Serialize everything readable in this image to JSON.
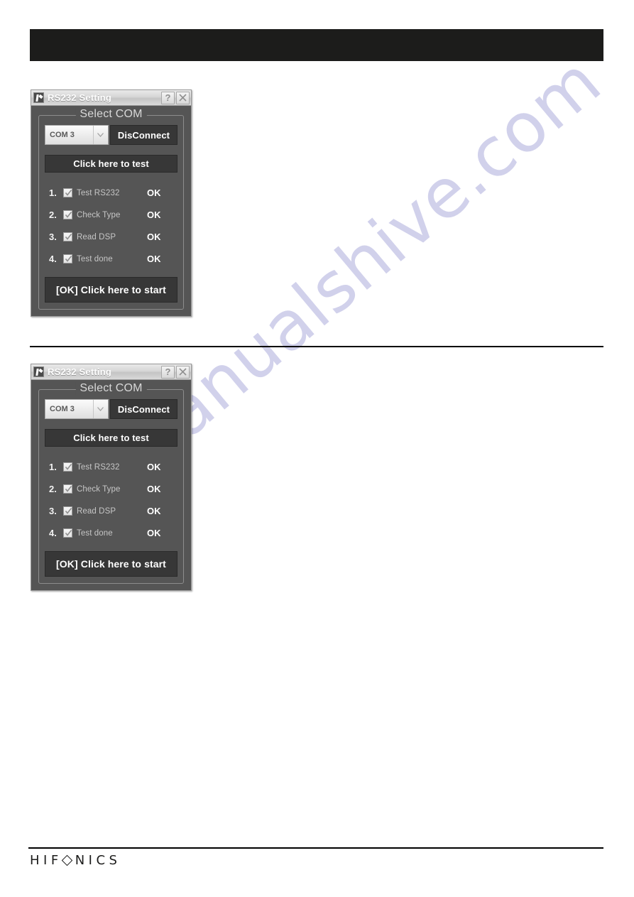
{
  "page": {
    "footer_logo": {
      "part1": "HIF",
      "diamond_icon": "diamond-glyph",
      "part2": "NICS"
    }
  },
  "watermark": {
    "text": "manualshive.com",
    "color": "#c9c9e8"
  },
  "colors": {
    "banner": "#1c1c1b",
    "dialog_bg": "#555555",
    "button_bg": "#373737",
    "rule": "#000000"
  },
  "dialogs": [
    {
      "titlebar": {
        "icon": "app-icon",
        "title": "RS232 Setting",
        "help_button": "?",
        "close_button": "close-icon"
      },
      "group": {
        "title": "Select COM",
        "combo": {
          "value": "COM 3",
          "arrow_icon": "chevron-down-icon",
          "options": [
            "COM 3"
          ]
        },
        "disconnect_button": "DisConnect",
        "test_button": "Click here to test",
        "steps": [
          {
            "num": "1.",
            "checked": true,
            "label": "Test RS232",
            "status": "OK"
          },
          {
            "num": "2.",
            "checked": true,
            "label": "Check Type",
            "status": "OK"
          },
          {
            "num": "3.",
            "checked": true,
            "label": "Read DSP",
            "status": "OK"
          },
          {
            "num": "4.",
            "checked": true,
            "label": "Test done",
            "status": "OK"
          }
        ],
        "start_button": "[OK] Click here to start"
      }
    },
    {
      "titlebar": {
        "icon": "app-icon",
        "title": "RS232 Setting",
        "help_button": "?",
        "close_button": "close-icon"
      },
      "group": {
        "title": "Select COM",
        "combo": {
          "value": "COM 3",
          "arrow_icon": "chevron-down-icon",
          "options": [
            "COM 3"
          ]
        },
        "disconnect_button": "DisConnect",
        "test_button": "Click here to test",
        "steps": [
          {
            "num": "1.",
            "checked": true,
            "label": "Test RS232",
            "status": "OK"
          },
          {
            "num": "2.",
            "checked": true,
            "label": "Check Type",
            "status": "OK"
          },
          {
            "num": "3.",
            "checked": true,
            "label": "Read DSP",
            "status": "OK"
          },
          {
            "num": "4.",
            "checked": true,
            "label": "Test done",
            "status": "OK"
          }
        ],
        "start_button": "[OK] Click here to start"
      }
    }
  ]
}
